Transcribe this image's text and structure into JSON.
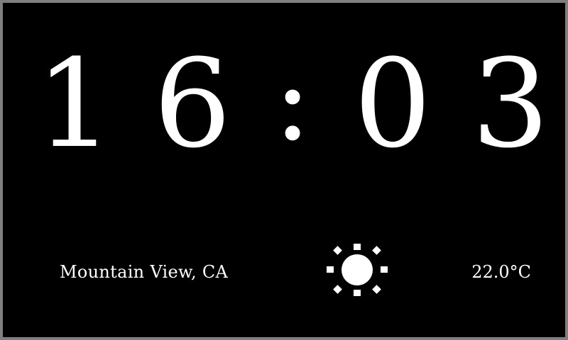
{
  "clock": {
    "hour_tens": "1",
    "hour_ones": "6",
    "separator": ":",
    "minute_tens": "0",
    "minute_ones": "3"
  },
  "weather": {
    "location": "Mountain View, CA",
    "condition_icon": "sun-icon",
    "temperature": "22.0°C"
  },
  "colors": {
    "background": "#000000",
    "border": "#7f7f7f",
    "foreground": "#ffffff"
  }
}
